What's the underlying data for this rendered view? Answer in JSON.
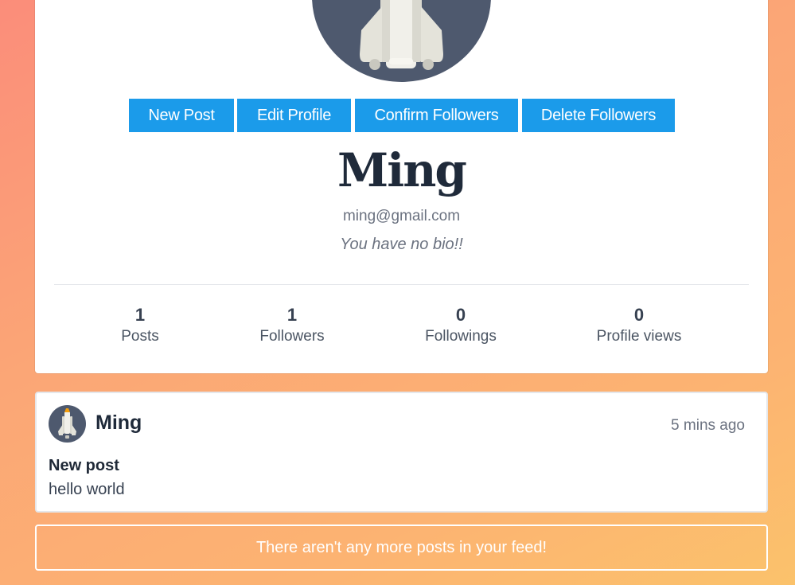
{
  "profile": {
    "name": "Ming",
    "email": "ming@gmail.com",
    "bio": "You have no bio!!",
    "actions": {
      "new_post": "New Post",
      "edit_profile": "Edit Profile",
      "confirm_followers": "Confirm Followers",
      "delete_followers": "Delete Followers"
    },
    "stats": [
      {
        "value": "1",
        "label": "Posts"
      },
      {
        "value": "1",
        "label": "Followers"
      },
      {
        "value": "0",
        "label": "Followings"
      },
      {
        "value": "0",
        "label": "Profile views"
      }
    ]
  },
  "posts": [
    {
      "author": "Ming",
      "time": "5 mins ago",
      "title": "New post",
      "body": "hello world"
    }
  ],
  "feed_end_message": "There aren't any more posts in your feed!",
  "colors": {
    "button": "#1b9bea",
    "avatar_bg": "#4e596e",
    "gradient_start": "#fb8d7a",
    "gradient_end": "#fbc26b"
  },
  "icons": {
    "avatar": "space-shuttle-icon"
  }
}
